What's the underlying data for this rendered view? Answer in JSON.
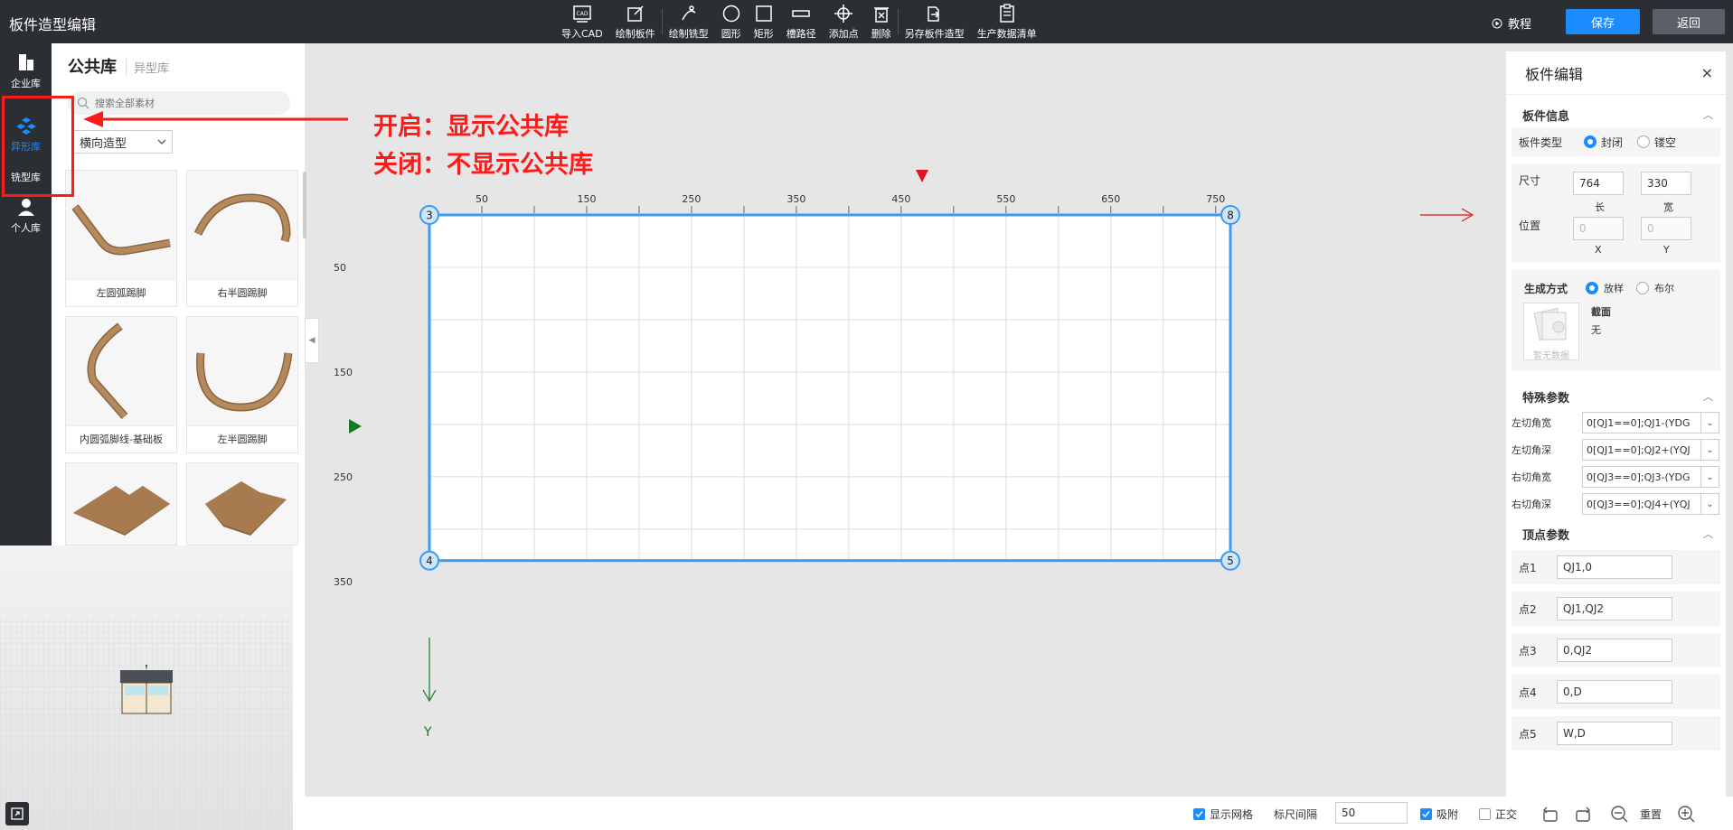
{
  "app": {
    "title": "板件造型编辑"
  },
  "toolbar": {
    "tools": [
      {
        "label": "导入CAD",
        "icon": "cad-import-icon"
      },
      {
        "label": "绘制板件",
        "icon": "draw-board-icon"
      },
      {
        "label": "绘制铣型",
        "icon": "draw-milling-icon"
      },
      {
        "label": "圆形",
        "icon": "circle-icon"
      },
      {
        "label": "矩形",
        "icon": "rectangle-icon"
      },
      {
        "label": "槽路径",
        "icon": "groove-path-icon"
      },
      {
        "label": "添加点",
        "icon": "add-point-icon"
      },
      {
        "label": "删除",
        "icon": "delete-icon"
      },
      {
        "label": "另存板件造型",
        "icon": "save-as-icon"
      },
      {
        "label": "生产数据清单",
        "icon": "production-list-icon"
      }
    ],
    "cad_badge": "CAD",
    "tutorial": "教程",
    "save": "保存",
    "back": "返回"
  },
  "nav": {
    "items": [
      {
        "label": "企业库"
      },
      {
        "label": "异形库"
      },
      {
        "label": "铣型库"
      },
      {
        "label": "个人库"
      }
    ],
    "active_color": "#1a8cff"
  },
  "library": {
    "tab_public": "公共库",
    "tab_special": "异型库",
    "search_placeholder": "搜索全部素材",
    "filter": "横向造型",
    "items": [
      {
        "label": "左圆弧踢脚"
      },
      {
        "label": "右半圆踢脚"
      },
      {
        "label": "内圆弧脚线-基础板"
      },
      {
        "label": "左半圆踢脚"
      },
      {
        "label": ""
      },
      {
        "label": ""
      }
    ]
  },
  "annotation": {
    "line1": "开启：显示公共库",
    "line2": "关闭：不显示公共库",
    "color": "#ff1a1a"
  },
  "canvas": {
    "x_ticks": [
      "50",
      "150",
      "250",
      "350",
      "450",
      "550",
      "650",
      "750"
    ],
    "y_ticks": [
      "50",
      "150",
      "250",
      "350"
    ],
    "y_axis_label": "Y",
    "vertices": [
      "3",
      "8",
      "4",
      "5"
    ],
    "board_width": 764,
    "board_depth": 330
  },
  "edit_panel": {
    "title": "板件编辑",
    "close": "×",
    "board_info": {
      "heading": "板件信息",
      "type_label": "板件类型",
      "type_closed": "封闭",
      "type_hollow": "镂空",
      "size_label": "尺寸",
      "length": "764",
      "width": "330",
      "length_cap": "长",
      "width_cap": "宽",
      "pos_label": "位置",
      "pos_x": "0",
      "pos_y": "0",
      "x_cap": "X",
      "y_cap": "Y"
    },
    "gen": {
      "label": "生成方式",
      "opt_loft": "放样",
      "opt_bool": "布尔",
      "section_label": "截面",
      "section_value": "无",
      "no_data": "暂无数据"
    },
    "special": {
      "heading": "特殊参数",
      "rows": [
        {
          "key": "左切角宽",
          "value": "0[QJ1==0];QJ1-(YDG"
        },
        {
          "key": "左切角深",
          "value": "0[QJ1==0];QJ2+(YQJ"
        },
        {
          "key": "右切角宽",
          "value": "0[QJ3==0];QJ3-(YDG"
        },
        {
          "key": "右切角深",
          "value": "0[QJ3==0];QJ4+(YQJ"
        }
      ]
    },
    "vertex": {
      "heading": "顶点参数",
      "rows": [
        {
          "key": "点1",
          "value": "QJ1,0"
        },
        {
          "key": "点2",
          "value": "QJ1,QJ2"
        },
        {
          "key": "点3",
          "value": "0,QJ2"
        },
        {
          "key": "点4",
          "value": "0,D"
        },
        {
          "key": "点5",
          "value": "W,D"
        }
      ]
    }
  },
  "bottom": {
    "show_grid": "显示网格",
    "ruler_interval_label": "标尺间隔",
    "ruler_interval": "50",
    "snap": "吸附",
    "ortho": "正交",
    "reset": "重置"
  }
}
